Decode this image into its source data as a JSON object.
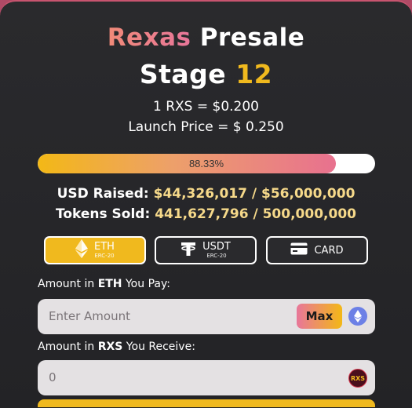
{
  "title": {
    "brand": "Rexas",
    "rest": " Presale",
    "stage_label": "Stage ",
    "stage_number": "12"
  },
  "rate_text": "1 RXS = $0.200",
  "launch_text": "Launch Price = $ 0.250",
  "progress": {
    "percent_value": 88.33,
    "label": "88.33%"
  },
  "usd_raised": {
    "label": "USD Raised:",
    "value": "$44,326,017 / $56,000,000"
  },
  "tokens_sold": {
    "label": "Tokens Sold:",
    "value": "441,627,796 / 500,000,000"
  },
  "pay_tabs": [
    {
      "label": "ETH",
      "sub": "ERC-20",
      "icon": "ethereum-icon",
      "active": true
    },
    {
      "label": "USDT",
      "sub": "ERC-20",
      "icon": "tether-icon",
      "active": false
    },
    {
      "label": "CARD",
      "sub": "",
      "icon": "card-icon",
      "active": false
    }
  ],
  "pay_field": {
    "label_pre": "Amount in ",
    "label_bold": "ETH",
    "label_post": " You Pay:",
    "placeholder": "Enter Amount",
    "max_label": "Max",
    "icon": "ethereum-icon"
  },
  "receive_field": {
    "label_pre": "Amount in ",
    "label_bold": "RXS",
    "label_post": " You Receive:",
    "value": "0",
    "icon": "rxs-logo-icon",
    "logo_text": "RXS"
  },
  "colors": {
    "accent_gold": "#f0b91e",
    "accent_pink": "#e8769a",
    "card_bg": "#2a2a2d",
    "field_bg": "#e4e1e3"
  }
}
